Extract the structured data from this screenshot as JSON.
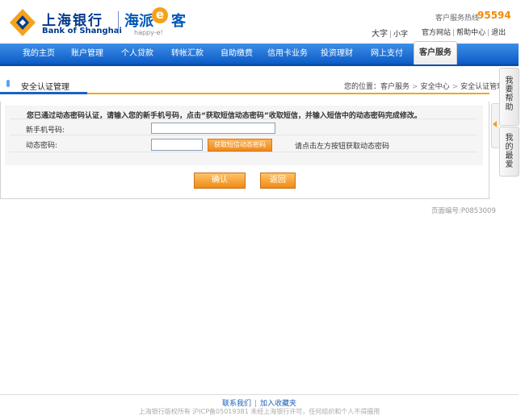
{
  "header": {
    "bank_name_cn": "上海银行",
    "bank_name_en": "Bank of Shanghai",
    "sub_brand_cn": "海派",
    "sub_brand_e": "e",
    "sub_brand_cn2": "客",
    "sub_brand_en": "happy-e!",
    "hotline_label": "客户服务热线",
    "hotline_number": "95594",
    "font_large": "大字",
    "font_small": "小字",
    "links": {
      "official_site": "官方网站",
      "help_center": "帮助中心",
      "logout": "退出"
    },
    "brand_colors": {
      "primary": "#003a8c",
      "accent": "#f4a21b"
    }
  },
  "nav": {
    "items": [
      {
        "label": "我的主页"
      },
      {
        "label": "账户管理"
      },
      {
        "label": "个人贷款"
      },
      {
        "label": "转帐汇款"
      },
      {
        "label": "自助缴费"
      },
      {
        "label": "信用卡业务"
      },
      {
        "label": "投资理财"
      },
      {
        "label": "网上支付"
      },
      {
        "label": "客户服务"
      }
    ],
    "active_index": 8
  },
  "title_bar": {
    "title": "安全认证管理",
    "breadcrumb_prefix": "您的位置：",
    "crumbs": [
      "客户服务",
      "安全中心",
      "安全认证管理"
    ],
    "arrow": ">"
  },
  "form": {
    "notice": "您已通过动态密码认证，请输入您的新手机号码，点击“获取短信动态密码”收取短信，并输入短信中的动态密码完成修改。",
    "phone_label": "新手机号码:",
    "phone_value": "",
    "code_label": "动态密码:",
    "code_value": "",
    "get_code_button": "获取短信动态密码",
    "code_hint": "请点击左方按钮获取动态密码",
    "confirm_button": "确认",
    "back_button": "返回"
  },
  "page_code": "页面编号:P0853009",
  "side_widget": {
    "help_label": "我要帮助",
    "favorite_label": "我的最爱"
  },
  "footer": {
    "contact_us": "联系我们",
    "add_favorite": "加入收藏夹",
    "copyright": "上海银行版权所有  沪ICP备05019381  未经上海银行许可，任何组织和个人不得擅用"
  }
}
